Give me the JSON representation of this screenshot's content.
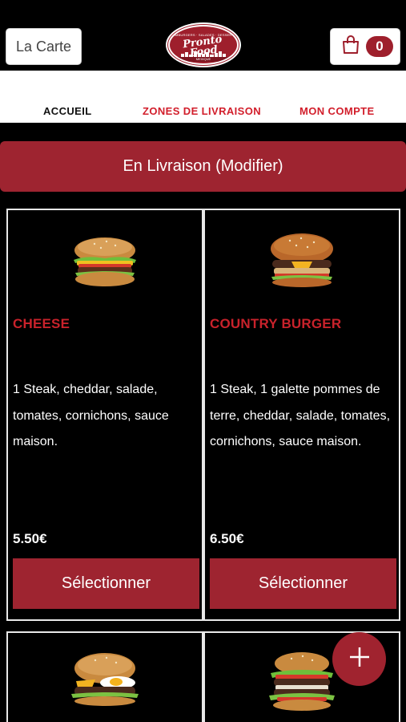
{
  "header": {
    "menu_button_label": "La Carte",
    "logo": {
      "small_text": "HAMBURGERS · SALADES · DESSERTS",
      "line1": "Pronto",
      "line2": "Food",
      "place": "MEXIQUE"
    },
    "cart_count": "0"
  },
  "nav": {
    "home": "ACCUEIL",
    "zones": "ZONES DE LIVRAISON",
    "account": "MON COMPTE"
  },
  "delivery_mode": "En Livraison (Modifier)",
  "products": [
    {
      "name": "CHEESE",
      "description": "1 Steak, cheddar, salade, tomates, cornichons, sauce maison.",
      "price": "5.50€",
      "select_label": "Sélectionner"
    },
    {
      "name": "COUNTRY BURGER",
      "description": "1 Steak, 1 galette pommes de terre, cheddar, salade, tomates, cornichons, sauce maison.",
      "price": "6.50€",
      "select_label": "Sélectionner"
    }
  ],
  "colors": {
    "accent": "#9e2430",
    "product_name": "#c9222b",
    "nav_active": "#111111",
    "nav_link": "#d21e2b"
  },
  "icons": [
    "shopping-bag-icon",
    "plus-icon"
  ]
}
